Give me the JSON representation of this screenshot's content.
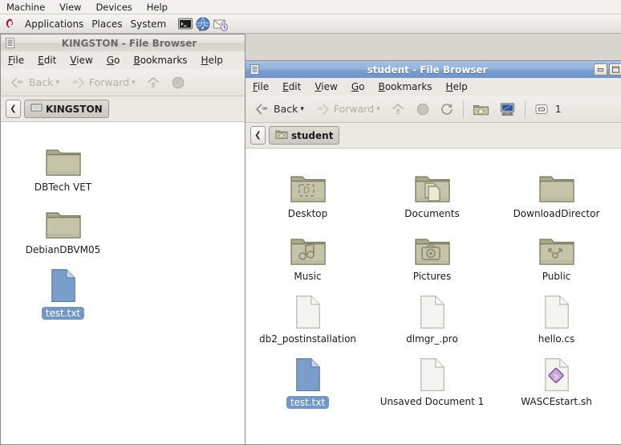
{
  "vbox_menu": {
    "items": [
      "Machine",
      "View",
      "Devices",
      "Help"
    ]
  },
  "gnome_panel": {
    "logo_icon": "debian-swirl-icon",
    "menus": [
      "Applications",
      "Places",
      "System"
    ],
    "launchers": [
      {
        "name": "terminal-icon",
        "label": "Terminal"
      },
      {
        "name": "web-browser-icon",
        "label": "Web Browser"
      },
      {
        "name": "email-icon",
        "label": "Email"
      }
    ]
  },
  "windows": [
    {
      "id": "kingston",
      "title": "KINGSTON - File Browser",
      "active": false,
      "menubar": [
        "File",
        "Edit",
        "View",
        "Go",
        "Bookmarks",
        "Help"
      ],
      "toolbar": {
        "back_label": "Back",
        "back_enabled": false,
        "forward_label": "Forward",
        "forward_enabled": false,
        "up_icon": "up-arrow-icon",
        "stop_icon": "stop-icon"
      },
      "pathbar": {
        "prev_icon": "chevron-left-icon",
        "crumb_icon": "drive-icon",
        "crumb_label": "KINGSTON"
      },
      "files": [
        {
          "name": "DBTech VET",
          "type": "folder",
          "emblem": "none",
          "selected": false
        },
        {
          "name": "DebianDBVM05",
          "type": "folder",
          "emblem": "none",
          "selected": false
        },
        {
          "name": "test.txt",
          "type": "text-file",
          "emblem": "none",
          "selected": true
        }
      ]
    },
    {
      "id": "student",
      "title": "student - File Browser",
      "active": true,
      "menubar": [
        "File",
        "Edit",
        "View",
        "Go",
        "Bookmarks",
        "Help"
      ],
      "toolbar": {
        "back_label": "Back",
        "back_enabled": true,
        "forward_label": "Forward",
        "forward_enabled": false,
        "up_icon": "up-arrow-icon",
        "stop_icon": "stop-icon",
        "reload_icon": "reload-icon",
        "home_icon": "home-folder-icon",
        "computer_icon": "computer-icon",
        "zoom_icon": "zoom-level-icon",
        "zoom_level": "1"
      },
      "pathbar": {
        "prev_icon": "chevron-left-icon",
        "crumb_icon": "home-folder-icon",
        "crumb_label": "student"
      },
      "window_buttons": [
        {
          "name": "minimize-button",
          "glyph": "_"
        },
        {
          "name": "maximize-button",
          "glyph": "□"
        }
      ],
      "files": [
        {
          "name": "Desktop",
          "type": "folder",
          "emblem": "desktop",
          "selected": false
        },
        {
          "name": "Documents",
          "type": "folder",
          "emblem": "documents",
          "selected": false
        },
        {
          "name": "DownloadDirector",
          "type": "folder",
          "emblem": "none",
          "selected": false
        },
        {
          "name": "Music",
          "type": "folder",
          "emblem": "music",
          "selected": false
        },
        {
          "name": "Pictures",
          "type": "folder",
          "emblem": "pictures",
          "selected": false
        },
        {
          "name": "Public",
          "type": "folder",
          "emblem": "public",
          "selected": false
        },
        {
          "name": "db2_postinstallation",
          "type": "blank-file",
          "emblem": "none",
          "selected": false
        },
        {
          "name": "dlmgr_.pro",
          "type": "blank-file",
          "emblem": "none",
          "selected": false
        },
        {
          "name": "hello.cs",
          "type": "blank-file",
          "emblem": "none",
          "selected": false
        },
        {
          "name": "test.txt",
          "type": "text-file",
          "emblem": "none",
          "selected": true
        },
        {
          "name": "Unsaved Document 1",
          "type": "blank-file",
          "emblem": "none",
          "selected": false
        },
        {
          "name": "WASCEstart.sh",
          "type": "script-file",
          "emblem": "script",
          "selected": false
        }
      ]
    }
  ],
  "colors": {
    "selection_blue": "#7498c6",
    "active_title_top": "#a6c2e4",
    "active_title_bottom": "#6e94c8",
    "folder_fill": "#c5c4ab",
    "text_file_fill": "#7b9fcb",
    "desktop_bg": "#d8d5d0"
  }
}
